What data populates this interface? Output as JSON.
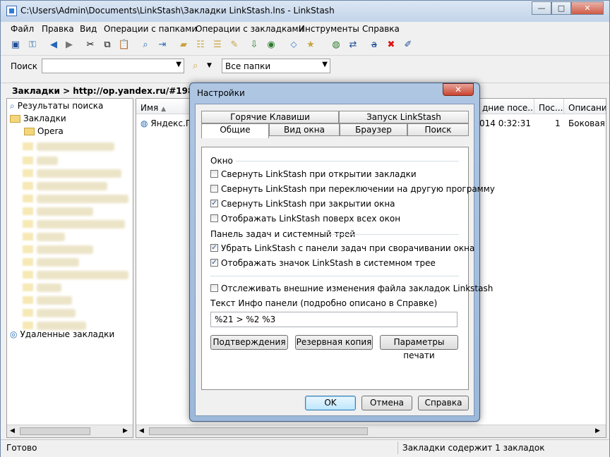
{
  "window": {
    "title": "C:\\Users\\Admin\\Documents\\LinkStash\\Закладки LinkStash.lns - LinkStash",
    "min": "—",
    "max": "□",
    "close": "✕"
  },
  "menu": [
    "Файл",
    "Правка",
    "Вид",
    "Операции с папками",
    "Операции с закладками",
    "Инструменты",
    "Справка"
  ],
  "search": {
    "label": "Поиск",
    "value": "",
    "folders": "Все папки"
  },
  "address": "Закладки > http://op.yandex.ru/#1985541.1",
  "tree": {
    "search_results": "Результаты поиска",
    "bookmarks": "Закладки",
    "opera": "Opera",
    "remote": "Удаленные закладки"
  },
  "list": {
    "columns": [
      "Имя",
      "дние посе...",
      "Пос...",
      "Описание"
    ],
    "row": {
      "name": "Яндекс.Па",
      "date": "014 0:32:31",
      "visits": "1",
      "desc": "Боковая п"
    }
  },
  "status": {
    "left": "Готово",
    "right": "Закладки содержит 1 закладок"
  },
  "dialog": {
    "title": "Настройки",
    "close": "✕",
    "tabs_top": [
      "Горячие Клавиши",
      "Запуск LinkStash"
    ],
    "tabs_bottom": [
      "Общие",
      "Вид окна",
      "Браузер",
      "Поиск"
    ],
    "group_window": "Окно",
    "opt_minimize_open": "Свернуть LinkStash при открытии закладки",
    "opt_minimize_switch": "Свернуть LinkStash при переключении на другую программу",
    "opt_minimize_close": "Свернуть LinkStash при закрытии окна",
    "opt_on_top": "Отображать LinkStash поверх всех окон",
    "group_tray": "Панель задач и системный трей",
    "opt_remove_taskbar": "Убрать LinkStash  с панели задач при сворачивании окна",
    "opt_show_tray": "Отображать значок LinkStash в системном трее",
    "opt_track_changes": "Отслеживать внешние изменения файла закладок Linkstash",
    "info_label": "Текст Инфо панели (подробно описано в Справке)",
    "info_value": "%21  >  %2  %3",
    "btn_confirm": "Подтверждения",
    "btn_backup": "Резервная копия",
    "btn_print": "Параметры печати",
    "btn_ok": "OK",
    "btn_cancel": "Отмена",
    "btn_help": "Справка",
    "checks": {
      "minimize_open": false,
      "minimize_switch": false,
      "minimize_close": true,
      "on_top": false,
      "remove_taskbar": true,
      "show_tray": true,
      "track_changes": false
    }
  }
}
